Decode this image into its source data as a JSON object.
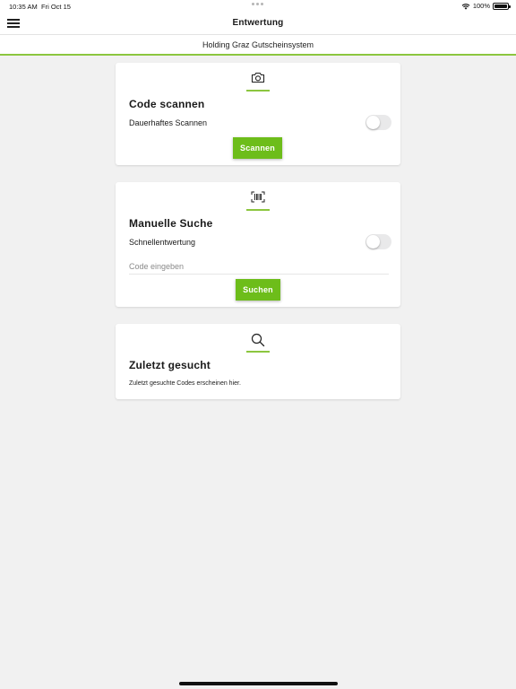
{
  "status_bar": {
    "time": "10:35 AM",
    "date": "Fri Oct 15",
    "battery": "100%"
  },
  "nav": {
    "title": "Entwertung",
    "menu_icon": "hamburger-menu-icon"
  },
  "sub_header": {
    "title": "Holding Graz Gutscheinsystem"
  },
  "cards": {
    "scan": {
      "icon": "camera-icon",
      "title": "Code scannen",
      "toggle_label": "Dauerhaftes Scannen",
      "toggle_on": false,
      "button_label": "Scannen"
    },
    "manual": {
      "icon": "barcode-icon",
      "title": "Manuelle Suche",
      "toggle_label": "Schnellentwertung",
      "toggle_on": false,
      "input_value": "",
      "input_placeholder": "Code eingeben",
      "button_label": "Suchen"
    },
    "recent": {
      "icon": "search-icon",
      "title": "Zuletzt gesucht",
      "hint": "Zuletzt gesuchte Codes erscheinen hier."
    }
  },
  "colors": {
    "accent": "#6dbd1a",
    "accent_line": "#8cc63f",
    "background": "#f1f1f1"
  }
}
